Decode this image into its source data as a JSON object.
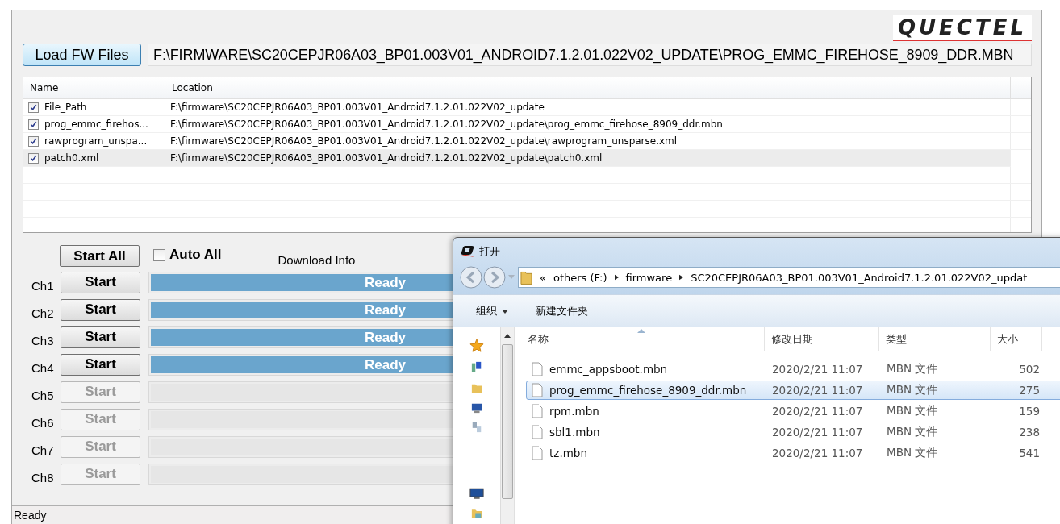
{
  "logo": "QUECTEL",
  "load_button": "Load FW Files",
  "fw_path": "F:\\FIRMWARE\\SC20CEPJR06A03_BP01.003V01_ANDROID7.1.2.01.022V02_UPDATE\\PROG_EMMC_FIREHOSE_8909_DDR.MBN",
  "table": {
    "columns": [
      "Name",
      "Location"
    ],
    "rows": [
      {
        "checked": true,
        "name": "File_Path",
        "location": "F:\\firmware\\SC20CEPJR06A03_BP01.003V01_Android7.1.2.01.022V02_update",
        "selected": false
      },
      {
        "checked": true,
        "name": "prog_emmc_firehos...",
        "location": "F:\\firmware\\SC20CEPJR06A03_BP01.003V01_Android7.1.2.01.022V02_update\\prog_emmc_firehose_8909_ddr.mbn",
        "selected": false
      },
      {
        "checked": true,
        "name": "rawprogram_unspa...",
        "location": "F:\\firmware\\SC20CEPJR06A03_BP01.003V01_Android7.1.2.01.022V02_update\\rawprogram_unsparse.xml",
        "selected": false
      },
      {
        "checked": true,
        "name": "patch0.xml",
        "location": "F:\\firmware\\SC20CEPJR06A03_BP01.003V01_Android7.1.2.01.022V02_update\\patch0.xml",
        "selected": true
      }
    ]
  },
  "start_all": "Start All",
  "auto_all": {
    "label": "Auto All",
    "checked": false
  },
  "download_info": "Download Info",
  "channels": [
    {
      "label": "Ch1",
      "button": "Start",
      "enabled": true,
      "status": "Ready"
    },
    {
      "label": "Ch2",
      "button": "Start",
      "enabled": true,
      "status": "Ready"
    },
    {
      "label": "Ch3",
      "button": "Start",
      "enabled": true,
      "status": "Ready"
    },
    {
      "label": "Ch4",
      "button": "Start",
      "enabled": true,
      "status": "Ready"
    },
    {
      "label": "Ch5",
      "button": "Start",
      "enabled": false
    },
    {
      "label": "Ch6",
      "button": "Start",
      "enabled": false
    },
    {
      "label": "Ch7",
      "button": "Start",
      "enabled": false
    },
    {
      "label": "Ch8",
      "button": "Start",
      "enabled": false
    }
  ],
  "status_bar": "Ready",
  "dialog": {
    "title": "打开",
    "breadcrumb": [
      "«",
      "others (F:)",
      "firmware",
      "SC20CEPJR06A03_BP01.003V01_Android7.1.2.01.022V02_updat"
    ],
    "toolbar": [
      "组织",
      "新建文件夹"
    ],
    "columns": [
      "名称",
      "修改日期",
      "类型",
      "大小"
    ],
    "files": [
      {
        "name": "emmc_appsboot.mbn",
        "date": "2020/2/21 11:07",
        "type": "MBN 文件",
        "size": "502",
        "selected": false
      },
      {
        "name": "prog_emmc_firehose_8909_ddr.mbn",
        "date": "2020/2/21 11:07",
        "type": "MBN 文件",
        "size": "275",
        "selected": true
      },
      {
        "name": "rpm.mbn",
        "date": "2020/2/21 11:07",
        "type": "MBN 文件",
        "size": "159",
        "selected": false
      },
      {
        "name": "sbl1.mbn",
        "date": "2020/2/21 11:07",
        "type": "MBN 文件",
        "size": "238",
        "selected": false
      },
      {
        "name": "tz.mbn",
        "date": "2020/2/21 11:07",
        "type": "MBN 文件",
        "size": "541",
        "selected": false
      }
    ]
  }
}
